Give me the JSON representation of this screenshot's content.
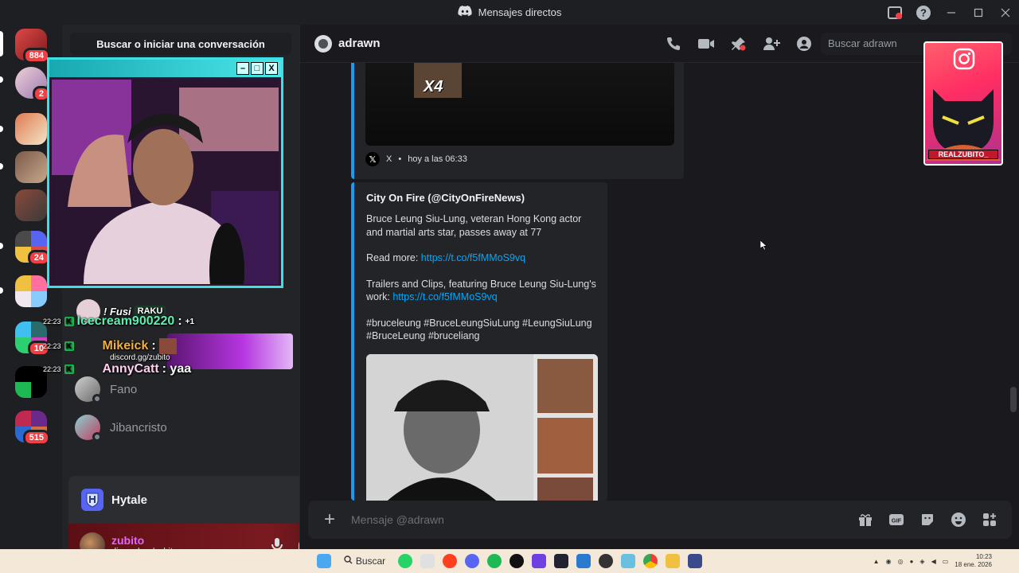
{
  "window": {
    "title": "Mensajes directos"
  },
  "rail": {
    "badges": {
      "home": "884",
      "server1": "2",
      "server6": "24",
      "server8": "10",
      "server10": "515"
    }
  },
  "sidebar": {
    "search_label": "Buscar o iniciar una conversación",
    "dms": [
      {
        "name": "Fano"
      },
      {
        "name": "Jibancristo"
      }
    ]
  },
  "overlay_chat": [
    {
      "time": "",
      "user": "! Fusi",
      "tag": "RAKU",
      "text": ""
    },
    {
      "time": "22:23",
      "user": "Icecream900220",
      "text": ":",
      "extra": "+1"
    },
    {
      "time": "22:23",
      "user": "Mikeick",
      "text": ":",
      "sub": "discord.gg/zubito"
    },
    {
      "time": "22:23",
      "user": "AnnyCatt",
      "text": ": yaa"
    }
  ],
  "game": {
    "name": "Hytale"
  },
  "user_panel": {
    "name": "zubito",
    "status": "discord.gg/zubito"
  },
  "chat": {
    "recipient": "adrawn",
    "search_placeholder": "Buscar adrawn",
    "embed1": {
      "overlay_text": "X4",
      "source": "X",
      "time": "hoy a las 06:33"
    },
    "embed2": {
      "author": "City On Fire (@CityOnFireNews)",
      "paragraph1": "Bruce Leung Siu-Lung, veteran Hong Kong actor and martial arts star, passes away at 77",
      "readmore_label": "Read more:",
      "readmore_link": "https://t.co/f5fMMoS9vq",
      "trailers_text": "Trailers and Clips, featuring Bruce Leung Siu-Lung's work:",
      "trailers_link": "https://t.co/f5fMMoS9vq",
      "hashtags": "#bruceleung #BruceLeungSiuLung #LeungSiuLung #BruceLeung #bruceliang"
    },
    "composer_placeholder": "Mensaje @adrawn"
  },
  "ig_card": {
    "label": "REALZUBITO_"
  },
  "taskbar": {
    "search_label": "Buscar",
    "time": "10:23",
    "date": "18 ene. 2026"
  },
  "colors": {
    "accent_link": "#00a8fc",
    "embed_border": "#1d9bf0",
    "badge_red": "#f23f43",
    "webcam_border": "#3fe0e3"
  }
}
